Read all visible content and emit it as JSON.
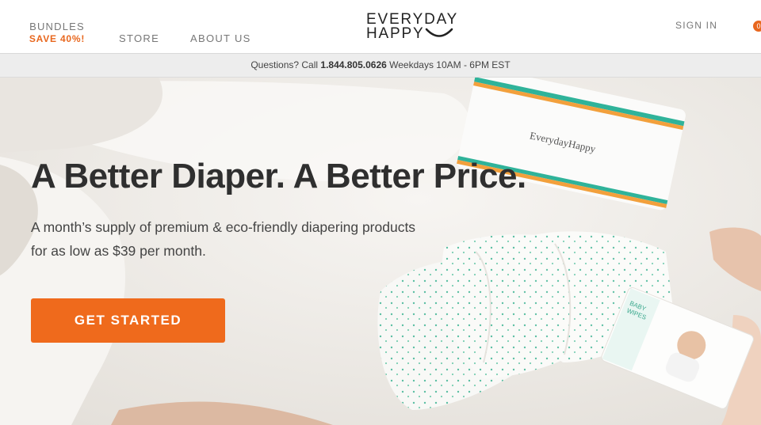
{
  "nav": {
    "bundles_label": "BUNDLES",
    "bundles_promo": "SAVE 40%!",
    "store_label": "STORE",
    "about_label": "ABOUT US",
    "signin_label": "SIGN IN",
    "cart_count": "0"
  },
  "logo": {
    "line1": "EVERYDAY",
    "line2": "HAPPY"
  },
  "infobar": {
    "prefix": "Questions? Call ",
    "phone": "1.844.805.0626",
    "hours": " Weekdays 10AM - 6PM EST"
  },
  "hero": {
    "headline": "A Better Diaper. A Better Price.",
    "subline_1": "A month’s supply of premium & eco-friendly diapering products",
    "subline_2": "for as low as $39 per month.",
    "cta_label": "GET STARTED",
    "package_brand": "EverydayHappy",
    "wipes_label_1": "BABY",
    "wipes_label_2": "WIPES"
  },
  "colors": {
    "accent": "#ef6a1c",
    "promo": "#e8671e",
    "text_dark": "#2f2f2f",
    "nav_text": "#777777",
    "infobar_bg": "#ededed"
  }
}
